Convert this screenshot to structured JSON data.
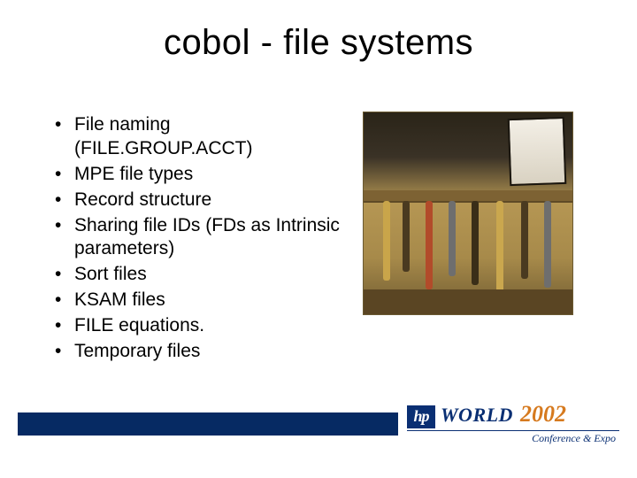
{
  "title": "cobol - file systems",
  "bullets": [
    "File naming (FILE.GROUP.ACCT)",
    "MPE file types",
    "Record structure",
    "Sharing file IDs (FDs as Intrinsic parameters)",
    "Sort files",
    "KSAM files",
    "FILE equations.",
    "Temporary files"
  ],
  "image": {
    "alt": "Workshop tool rack with pliers and hand tools hanging below a shelf; small framed child portrait on the shelf."
  },
  "footer": {
    "hp": "hp",
    "world": "WORLD",
    "year": "2002",
    "tagline": "Conference & Expo"
  },
  "colors": {
    "footer_bar": "#062a63",
    "brand_blue": "#0a2f73",
    "brand_orange": "#d67a1f"
  }
}
